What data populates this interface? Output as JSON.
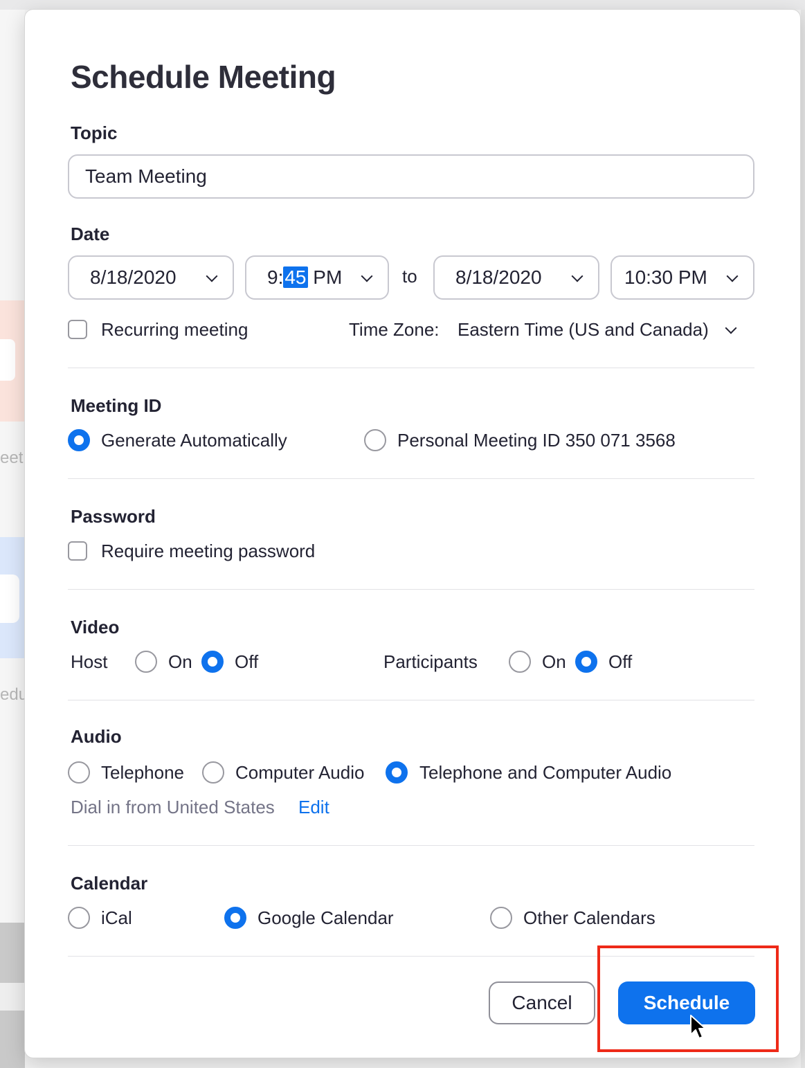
{
  "dialog": {
    "title": "Schedule Meeting"
  },
  "topic": {
    "label": "Topic",
    "value": "Team Meeting"
  },
  "date": {
    "label": "Date",
    "start_date": "8/18/2020",
    "start_time_hour": "9:",
    "start_time_minute": "45",
    "start_time_ampm": "PM",
    "to_label": "to",
    "end_date": "8/18/2020",
    "end_time": "10:30 PM",
    "recurring_label": "Recurring meeting",
    "recurring_checked": false,
    "timezone_label": "Time Zone:",
    "timezone_value": "Eastern Time (US and Canada)"
  },
  "meeting_id": {
    "label": "Meeting ID",
    "options": [
      "Generate Automatically",
      "Personal Meeting ID 350 071 3568"
    ],
    "selected": "Generate Automatically"
  },
  "password": {
    "label": "Password",
    "require_label": "Require meeting password",
    "checked": false
  },
  "video": {
    "label": "Video",
    "host_label": "Host",
    "participants_label": "Participants",
    "on_label": "On",
    "off_label": "Off",
    "host_selected": "Off",
    "participants_selected": "Off"
  },
  "audio": {
    "label": "Audio",
    "options": [
      "Telephone",
      "Computer Audio",
      "Telephone and Computer Audio"
    ],
    "selected": "Telephone and Computer Audio",
    "dial_in_text": "Dial in from United States",
    "edit_link": "Edit"
  },
  "calendar": {
    "label": "Calendar",
    "options": [
      "iCal",
      "Google Calendar",
      "Other Calendars"
    ],
    "selected": "Google Calendar"
  },
  "footer": {
    "cancel_label": "Cancel",
    "schedule_label": "Schedule"
  },
  "background": {
    "text1": "eet",
    "text2": "edu"
  },
  "colors": {
    "accent": "#0e72ed",
    "annotation_box": "#ee2a18"
  }
}
